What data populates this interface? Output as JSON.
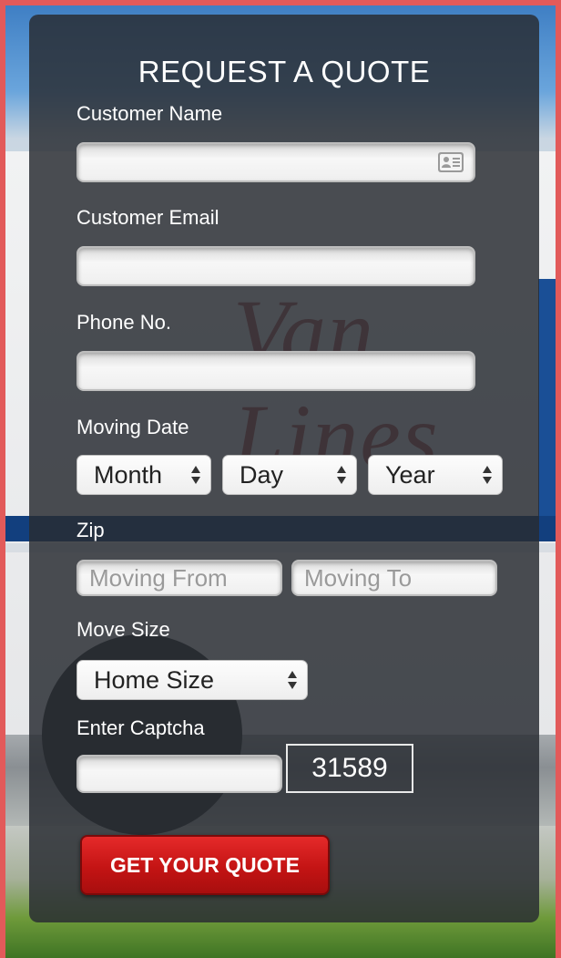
{
  "form": {
    "title": "REQUEST A QUOTE",
    "customer_name": {
      "label": "Customer Name",
      "value": ""
    },
    "customer_email": {
      "label": "Customer Email",
      "value": ""
    },
    "phone": {
      "label": "Phone No.",
      "value": ""
    },
    "moving_date": {
      "label": "Moving Date",
      "month": "Month",
      "day": "Day",
      "year": "Year"
    },
    "zip": {
      "label": "Zip",
      "from_placeholder": "Moving From",
      "to_placeholder": "Moving To"
    },
    "move_size": {
      "label": "Move Size",
      "selected": "Home Size"
    },
    "captcha": {
      "label": "Enter Captcha",
      "code": "31589",
      "value": ""
    },
    "submit_label": "GET YOUR QUOTE"
  },
  "icons": {
    "contact_card": "contact-card-icon",
    "select_arrows": "up-down-arrows-icon"
  },
  "colors": {
    "submit": "#c41414",
    "panel": "#282c32",
    "page_border": "#e25a5a"
  }
}
